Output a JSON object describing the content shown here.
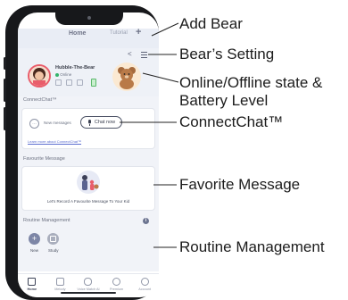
{
  "app": {
    "title": "Home",
    "tutorial_label": "Tutorial",
    "add_icon": "plus-icon"
  },
  "bear": {
    "name": "Hubble-The-Bear",
    "state": "Online"
  },
  "connect_chat": {
    "section_title": "ConnectChat™",
    "new_messages": "New messages",
    "chat_button": "Chat now",
    "learn_more": "Learn more about ConnectChat™"
  },
  "favourite": {
    "section_title": "Favourite Message",
    "caption": "Let's Record A Favourite Message To Your Kid"
  },
  "routine": {
    "section_title": "Routine Management",
    "items": [
      {
        "label": "New",
        "color": "#7d86a6"
      },
      {
        "label": "Study",
        "color": "#a9aebd"
      }
    ]
  },
  "tabs": [
    {
      "label": "Home",
      "icon": "home-icon"
    },
    {
      "label": "Melody",
      "icon": "melody-icon"
    },
    {
      "label": "Voice Match AI",
      "icon": "microphone-icon"
    },
    {
      "label": "Premium",
      "icon": "crown-icon"
    },
    {
      "label": "Account",
      "icon": "account-icon"
    }
  ],
  "callouts": {
    "add_bear": "Add Bear",
    "bear_setting": "Bear’s Setting",
    "state_line1": "Online/Offline state &",
    "state_line2": "Battery Level",
    "connectchat": "ConnectChat™",
    "favorite": "Favorite Message",
    "routine": "Routine Management"
  },
  "colors": {
    "accent": "#e95d6b",
    "online": "#34b36b",
    "link": "#5c6ed0"
  }
}
